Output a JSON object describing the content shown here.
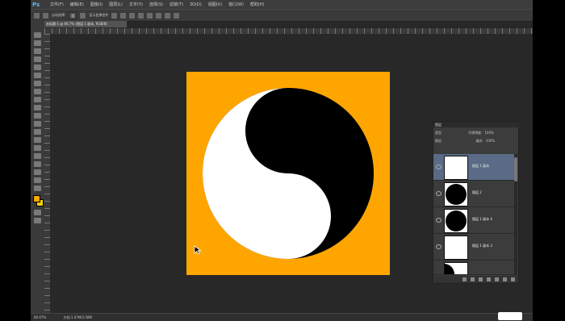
{
  "app": {
    "logo": "Ps"
  },
  "menubar": {
    "items": [
      "文件(F)",
      "编辑(E)",
      "图像(I)",
      "图层(L)",
      "文字(Y)",
      "选择(S)",
      "滤镜(T)",
      "3D(D)",
      "视图(V)",
      "窗口(W)",
      "帮助(H)"
    ]
  },
  "options": {
    "auto_select_label": "自动选择:",
    "auto_select_value": "组",
    "show_transform_label": "显示变换控件"
  },
  "document": {
    "tab_title": "未标题-1 @ 66.7% (图层 1 副本, RGB/8)"
  },
  "status": {
    "zoom": "66.67%",
    "doc_info": "文档:1.07M/3.58M"
  },
  "layers_panel": {
    "title": "图层",
    "kind_label": "类型",
    "opacity_label": "不透明度:",
    "opacity_value": "100%",
    "lock_label": "锁定:",
    "fill_label": "填充:",
    "fill_value": "100%",
    "layers": [
      {
        "name": "图层 1 副本",
        "thumb": "white",
        "selected": true
      },
      {
        "name": "图层 2",
        "thumb": "black-circle",
        "selected": false
      },
      {
        "name": "图层 1 副本 4",
        "thumb": "black-circle",
        "selected": false
      },
      {
        "name": "图层 1 副本 3",
        "thumb": "white",
        "selected": false
      }
    ]
  },
  "colors": {
    "canvas": "#ffa500",
    "selected_layer": "#596b86"
  }
}
